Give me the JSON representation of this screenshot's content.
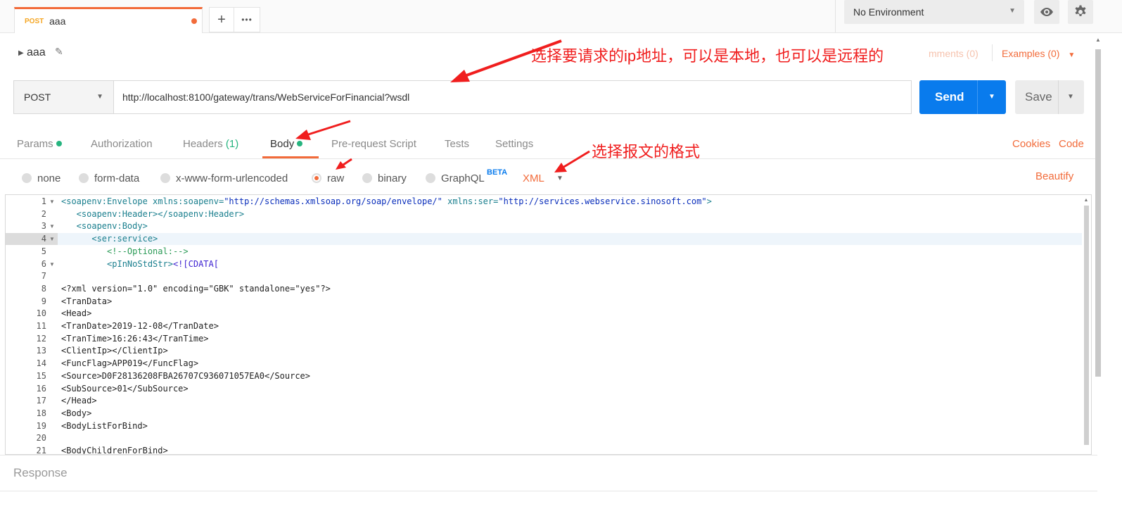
{
  "tabs": [
    {
      "method": "POST",
      "name": "aaa",
      "unsaved": true
    }
  ],
  "tab_actions": {
    "new_tab_icon": "+",
    "more_icon": "•••"
  },
  "environment": {
    "selected": "No Environment"
  },
  "request": {
    "name": "aaa",
    "comments_label": "mments (0)",
    "examples_label": "Examples (0)",
    "method": "POST",
    "url": "http://localhost:8100/gateway/trans/WebServiceForFinancial?wsdl",
    "send_label": "Send",
    "save_label": "Save"
  },
  "request_tabs": {
    "params": "Params",
    "authorization": "Authorization",
    "headers": "Headers",
    "headers_count": "(1)",
    "body": "Body",
    "pre_request": "Pre-request Script",
    "tests": "Tests",
    "settings": "Settings",
    "cookies": "Cookies",
    "code": "Code"
  },
  "body_types": {
    "none": "none",
    "form_data": "form-data",
    "urlencoded": "x-www-form-urlencoded",
    "raw": "raw",
    "binary": "binary",
    "graphql": "GraphQL",
    "beta": "BETA",
    "format": "XML",
    "beautify": "Beautify"
  },
  "editor_lines": [
    {
      "n": "1",
      "fold": true,
      "html_parts": [
        [
          "tg",
          "<soapenv:Envelope "
        ],
        [
          "at",
          "xmlns:soapenv="
        ],
        [
          "st",
          "\"http://schemas.xmlsoap.org/soap/envelope/\""
        ],
        [
          "at",
          " xmlns:ser="
        ],
        [
          "st",
          "\"http://services.webservice.sinosoft.com\""
        ],
        [
          "tg",
          ">"
        ]
      ]
    },
    {
      "n": "2",
      "fold": false,
      "html_parts": [
        [
          "tg",
          "   <soapenv:Header></soapenv:Header>"
        ]
      ]
    },
    {
      "n": "3",
      "fold": true,
      "html_parts": [
        [
          "tg",
          "   <soapenv:Body>"
        ]
      ]
    },
    {
      "n": "4",
      "fold": true,
      "html_parts": [
        [
          "tg",
          "      <ser:service>"
        ]
      ]
    },
    {
      "n": "5",
      "fold": false,
      "html_parts": [
        [
          "cm",
          "         <!--Optional:-->"
        ]
      ]
    },
    {
      "n": "6",
      "fold": true,
      "html_parts": [
        [
          "tg",
          "         <pInNoStdStr>"
        ],
        [
          "cd",
          "<![CDATA["
        ]
      ]
    },
    {
      "n": "7",
      "fold": false,
      "html_parts": [
        [
          "",
          ""
        ]
      ]
    },
    {
      "n": "8",
      "fold": false,
      "html_parts": [
        [
          "",
          "<?xml version=\"1.0\" encoding=\"GBK\" standalone=\"yes\"?>"
        ]
      ]
    },
    {
      "n": "9",
      "fold": false,
      "html_parts": [
        [
          "",
          "<TranData>"
        ]
      ]
    },
    {
      "n": "10",
      "fold": false,
      "html_parts": [
        [
          "",
          "<Head>"
        ]
      ]
    },
    {
      "n": "11",
      "fold": false,
      "html_parts": [
        [
          "",
          "<TranDate>2019-12-08</TranDate>"
        ]
      ]
    },
    {
      "n": "12",
      "fold": false,
      "html_parts": [
        [
          "",
          "<TranTime>16:26:43</TranTime>"
        ]
      ]
    },
    {
      "n": "13",
      "fold": false,
      "html_parts": [
        [
          "",
          "<ClientIp></ClientIp>"
        ]
      ]
    },
    {
      "n": "14",
      "fold": false,
      "html_parts": [
        [
          "",
          "<FuncFlag>APP019</FuncFlag>"
        ]
      ]
    },
    {
      "n": "15",
      "fold": false,
      "html_parts": [
        [
          "",
          "<Source>D0F28136208FBA26707C936071057EA0</Source>"
        ]
      ]
    },
    {
      "n": "16",
      "fold": false,
      "html_parts": [
        [
          "",
          "<SubSource>01</SubSource>"
        ]
      ]
    },
    {
      "n": "17",
      "fold": false,
      "html_parts": [
        [
          "",
          "</Head>"
        ]
      ]
    },
    {
      "n": "18",
      "fold": false,
      "html_parts": [
        [
          "",
          "<Body>"
        ]
      ]
    },
    {
      "n": "19",
      "fold": false,
      "html_parts": [
        [
          "",
          "<BodyListForBind>"
        ]
      ]
    },
    {
      "n": "20",
      "fold": false,
      "html_parts": [
        [
          "",
          ""
        ]
      ]
    },
    {
      "n": "21",
      "fold": false,
      "html_parts": [
        [
          "",
          "<BodyChildrenForBind>"
        ]
      ]
    }
  ],
  "response": {
    "title": "Response"
  },
  "annotations": {
    "url_note": "选择要请求的ip地址，可以是本地，也可以是远程的",
    "format_note": "选择报文的格式"
  },
  "colors": {
    "accent": "#f26b3a",
    "send": "#097bed",
    "status_green": "#26b47f",
    "annotation": "#f01e1e"
  }
}
